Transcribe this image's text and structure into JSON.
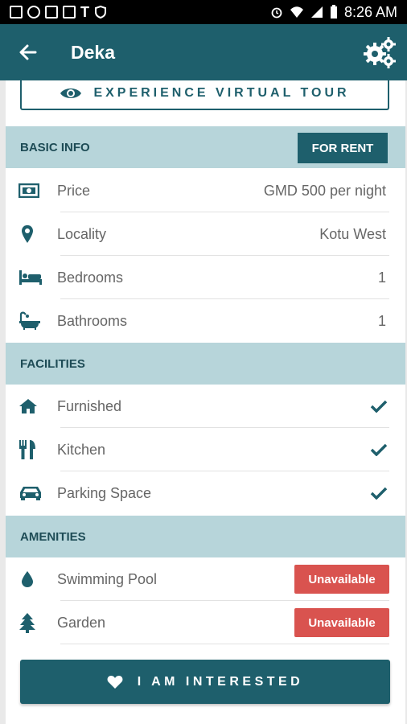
{
  "status_bar": {
    "time": "8:26 AM",
    "left_icons": [
      "gallery-icon",
      "settings-icon",
      "image-icon",
      "image-icon",
      "t-mobile-icon",
      "shield-icon"
    ],
    "right_icons": [
      "alarm-icon",
      "wifi-icon",
      "signal-icon",
      "battery-icon"
    ]
  },
  "appbar": {
    "title": "Deka",
    "back_icon": "arrow-left-icon",
    "settings_icon": "gears-icon",
    "color": "#1e5f6c"
  },
  "tour_button": {
    "label": "EXPERIENCE VIRTUAL TOUR",
    "icon": "eye-icon"
  },
  "basic_info": {
    "header": "BASIC INFO",
    "badge": "FOR RENT",
    "rows": [
      {
        "icon": "money-icon",
        "label": "Price",
        "value": "GMD 500 per night"
      },
      {
        "icon": "location-pin-icon",
        "label": "Locality",
        "value": "Kotu West"
      },
      {
        "icon": "bed-icon",
        "label": "Bedrooms",
        "value": "1"
      },
      {
        "icon": "bathtub-icon",
        "label": "Bathrooms",
        "value": "1"
      }
    ]
  },
  "facilities": {
    "header": "FACILITIES",
    "rows": [
      {
        "icon": "home-icon",
        "label": "Furnished",
        "status": "check-icon"
      },
      {
        "icon": "cutlery-icon",
        "label": "Kitchen",
        "status": "check-icon"
      },
      {
        "icon": "car-icon",
        "label": "Parking Space",
        "status": "check-icon"
      }
    ]
  },
  "amenities": {
    "header": "AMENITIES",
    "rows": [
      {
        "icon": "water-drop-icon",
        "label": "Swimming Pool",
        "status": "Unavailable"
      },
      {
        "icon": "tree-icon",
        "label": "Garden",
        "status": "Unavailable"
      }
    ]
  },
  "interested_button": {
    "label": "I AM INTERESTED",
    "icon": "heart-icon"
  },
  "colors": {
    "primary": "#1e5f6c",
    "section_bg": "#b7d5da",
    "unavailable": "#d9534f",
    "status_bar": "#000000"
  }
}
